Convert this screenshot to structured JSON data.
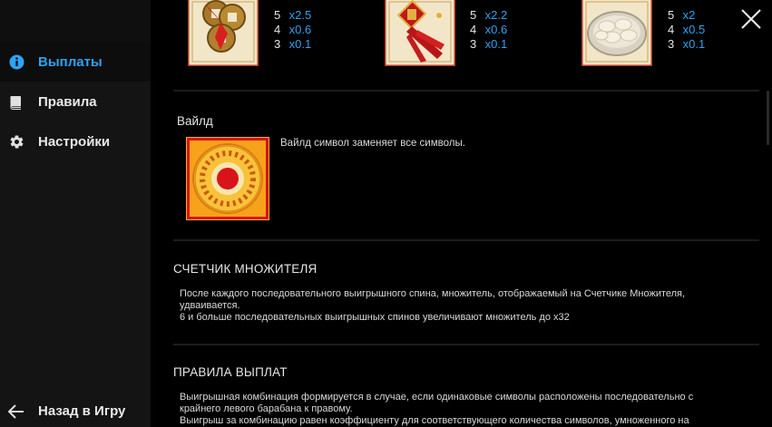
{
  "sidebar": {
    "items": [
      {
        "label": "Выплаты",
        "icon": "info-icon",
        "active": true
      },
      {
        "label": "Правила",
        "icon": "book-icon",
        "active": false
      },
      {
        "label": "Настройки",
        "icon": "gear-icon",
        "active": false
      }
    ],
    "back_label": "Назад в Игру"
  },
  "paytable": {
    "symbols": [
      {
        "icon": "coins-symbol-icon",
        "rows": [
          {
            "count": "5",
            "mult": "x2.5"
          },
          {
            "count": "4",
            "mult": "x0.6"
          },
          {
            "count": "3",
            "mult": "x0.1"
          }
        ]
      },
      {
        "icon": "firecracker-symbol-icon",
        "rows": [
          {
            "count": "5",
            "mult": "x2.2"
          },
          {
            "count": "4",
            "mult": "x0.6"
          },
          {
            "count": "3",
            "mult": "x0.1"
          }
        ]
      },
      {
        "icon": "dumplings-symbol-icon",
        "rows": [
          {
            "count": "5",
            "mult": "x2"
          },
          {
            "count": "4",
            "mult": "x0.5"
          },
          {
            "count": "3",
            "mult": "x0.1"
          }
        ]
      }
    ]
  },
  "wild": {
    "title": "Вайлд",
    "description": "Вайлд символ заменяет все символы."
  },
  "multiplier": {
    "title": "СЧЕТЧИК МНОЖИТЕЛЯ",
    "line1": "После каждого последовательного выигрышного спина, множитель, отображаемый на Счетчике Множителя,",
    "line2": "удваивается.",
    "line3": "6 и больше последовательных выигрышных спинов увеличивают множитель до x32"
  },
  "payout_rules": {
    "title": "ПРАВИЛА ВЫПЛАТ",
    "line1": "Выигрышная комбинация формируется в случае, если одинаковые символы расположены последовательно с",
    "line2": "крайнего левого барабана к правому.",
    "line3": "Выигрыш за комбинацию равен коэффициенту для соответствующего количества символов, умноженного на"
  },
  "colors": {
    "accent": "#2ea3f2",
    "sidebar_bg": "#141414",
    "main_bg": "#000000"
  }
}
